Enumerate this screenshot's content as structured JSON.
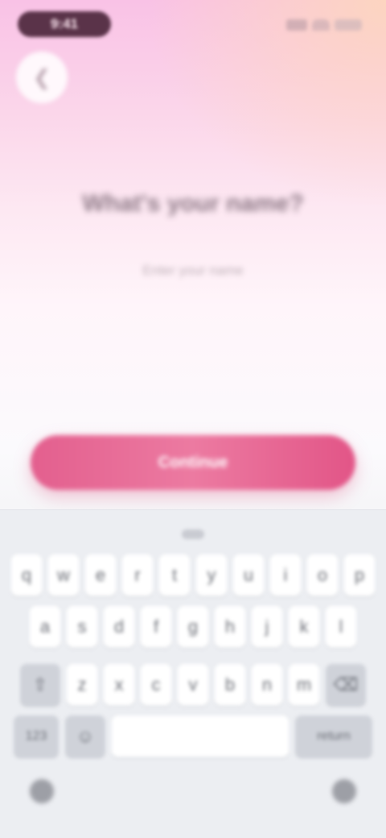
{
  "status_bar": {
    "time": "9:41"
  },
  "screen": {
    "back_icon": "chevron-left-icon",
    "title": "What's your name?",
    "subtitle": "Enter your name",
    "input_value": "",
    "primary_button_label": "Continue"
  },
  "keyboard": {
    "row1": [
      "q",
      "w",
      "e",
      "r",
      "t",
      "y",
      "u",
      "i",
      "o",
      "p"
    ],
    "row2": [
      "a",
      "s",
      "d",
      "f",
      "g",
      "h",
      "j",
      "k",
      "l"
    ],
    "row3": [
      "z",
      "x",
      "c",
      "v",
      "b",
      "n",
      "m"
    ],
    "shift_icon": "shift-icon",
    "delete_icon": "backspace-icon",
    "numbers_label": "123",
    "emoji_icon": "emoji-icon",
    "space_label": "space",
    "return_label": "return",
    "globe_icon": "globe-icon",
    "mic_icon": "microphone-icon"
  },
  "colors": {
    "accent": "#e35f8e",
    "background_top": "#f9c2e6",
    "keyboard_bg": "#eceef2"
  }
}
